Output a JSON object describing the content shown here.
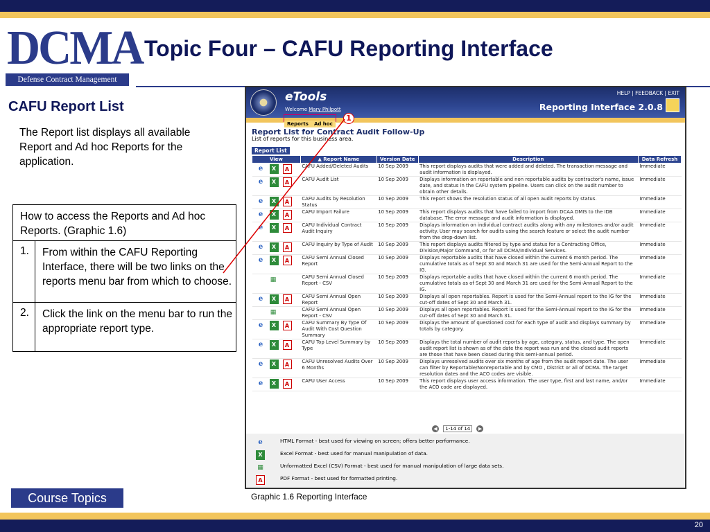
{
  "slide": {
    "title": "Topic Four – CAFU Reporting Interface",
    "logo_text": "DCMA",
    "logo_subtitle": "Defense Contract Management Agency",
    "section_title": "CAFU Report List",
    "intro": "The Report list displays all available Report and Ad hoc Reports for the application.",
    "steps_header": "How to access the Reports and Ad hoc Reports.  (Graphic 1.6)",
    "steps": [
      {
        "num": "1.",
        "text": "From within the CAFU Reporting Interface, there will be two links on the reports menu bar from which to choose."
      },
      {
        "num": "2.",
        "text": "Click the link on the menu bar to run the appropriate report type."
      }
    ],
    "course_button": "Course Topics",
    "caption": "Graphic 1.6 Reporting Interface",
    "page_number": "20",
    "colors": {
      "navy": "#141c59",
      "gold": "#f2c55c",
      "brand": "#2b3b8a"
    }
  },
  "app": {
    "brand": "eTools",
    "welcome": "Welcome",
    "user": "Mary Philpott",
    "top_links": "HELP  |  FEEDBACK  |  EXIT",
    "title": "Reporting Interface 2.0.8",
    "menu": [
      "Reports",
      "Ad hoc"
    ],
    "badge": "1",
    "list_title": "Report List for Contract Audit Follow-Up",
    "list_subtitle": "List of reports for this business area.",
    "tab": "Report List",
    "columns": [
      "View",
      "▲ Report Name",
      "Version Date",
      "Description",
      "Data Refresh"
    ],
    "rows": [
      {
        "name": "CAFU Added/Deleted Audits",
        "date": "10 Sep 2009",
        "desc": "This report displays audits that were added and deleted. The transaction message and audit information is displayed.",
        "refresh": "Immediate",
        "csv": false
      },
      {
        "name": "CAFU Audit List",
        "date": "10 Sep 2009",
        "desc": "Displays information on reportable and non reportable audits by contractor's name, issue date, and status in the CAFU system pipeline. Users can click on the audit number to obtain other details.",
        "refresh": "Immediate",
        "csv": false
      },
      {
        "name": "CAFU Audits by Resolution Status",
        "date": "10 Sep 2009",
        "desc": "This report shows the resolution status of all open audit reports by status.",
        "refresh": "Immediate",
        "csv": false
      },
      {
        "name": "CAFU Import Failure",
        "date": "10 Sep 2009",
        "desc": "This report displays audits that have failed to import from DCAA DMIS to the IDB database. The error message and audit information is displayed.",
        "refresh": "Immediate",
        "csv": false
      },
      {
        "name": "CAFU Individual Contract Audit Inquiry",
        "date": "10 Sep 2009",
        "desc": "Displays information on individual contract audits along with any milestones and/or audit activity. User may search for audits using the search feature or select the audit number from the drop-down list.",
        "refresh": "Immediate",
        "csv": false
      },
      {
        "name": "CAFU Inquiry by Type of Audit",
        "date": "10 Sep 2009",
        "desc": "This report displays audits filtered by type and status for a Contracting Office, Division/Major Command, or for all DCMA/Individual Services.",
        "refresh": "Immediate",
        "csv": false
      },
      {
        "name": "CAFU Semi Annual Closed Report",
        "date": "10 Sep 2009",
        "desc": "Displays reportable audits that have closed within the current 6 month period. The cumulative totals as of Sept 30 and March 31 are used for the Semi-Annual Report to the IG.",
        "refresh": "Immediate",
        "csv": false
      },
      {
        "name": "CAFU Semi Annual Closed Report - CSV",
        "date": "10 Sep 2009",
        "desc": "Displays reportable audits that have closed within the current 6 month period. The cumulative totals as of Sept 30 and March 31 are used for the Semi-Annual Report to the IG.",
        "refresh": "Immediate",
        "csv": true
      },
      {
        "name": "CAFU Semi Annual Open Report",
        "date": "10 Sep 2009",
        "desc": "Displays all open reportables. Report is used for the Semi-Annual report to the IG for the cut-off dates of Sept 30 and March 31.",
        "refresh": "Immediate",
        "csv": false
      },
      {
        "name": "CAFU Semi Annual Open Report - CSV",
        "date": "10 Sep 2009",
        "desc": "Displays all open reportables. Report is used for the Semi-Annual report to the IG for the cut-off dates of Sept 30 and March 31.",
        "refresh": "Immediate",
        "csv": true
      },
      {
        "name": "CAFU Summary By Type Of Audit With Cost Question Summary",
        "date": "10 Sep 2009",
        "desc": "Displays the amount of questioned cost for each type of audit and displays summary by totals by category.",
        "refresh": "Immediate",
        "csv": false
      },
      {
        "name": "CAFU Top Level Summary by Type",
        "date": "10 Sep 2009",
        "desc": "Displays the total number of audit reports by age, category, status, and type. The open audit report list is shown as of the date the report was run and the closed audit reports are those that have been closed during this semi-annual period.",
        "refresh": "Immediate",
        "csv": false
      },
      {
        "name": "CAFU Unresolved Audits Over 6 Months",
        "date": "10 Sep 2009",
        "desc": "Displays unresolved audits over six months of age from the audit report date. The user can filter by Reportable/Nonreportable and by CMO , District or all of DCMA. The target resolution dates and the ACO codes are visible.",
        "refresh": "Immediate",
        "csv": false
      },
      {
        "name": "CAFU User Access",
        "date": "10 Sep 2009",
        "desc": "This report displays user access information. The user type, first and last name, and/or the ACO code are displayed.",
        "refresh": "Immediate",
        "csv": false
      }
    ],
    "pager": "1-14 of 14",
    "legend": [
      {
        "icon": "ie-icon",
        "text": "HTML Format - best used for viewing on screen; offers better performance."
      },
      {
        "icon": "excel-icon",
        "text": "Excel Format - best used for manual manipulation of data."
      },
      {
        "icon": "csv-icon",
        "text": "Unformatted Excel (CSV) Format - best used for manual manipulation of large data sets."
      },
      {
        "icon": "pdf-icon",
        "text": "PDF Format - best used for formatted printing."
      }
    ]
  }
}
